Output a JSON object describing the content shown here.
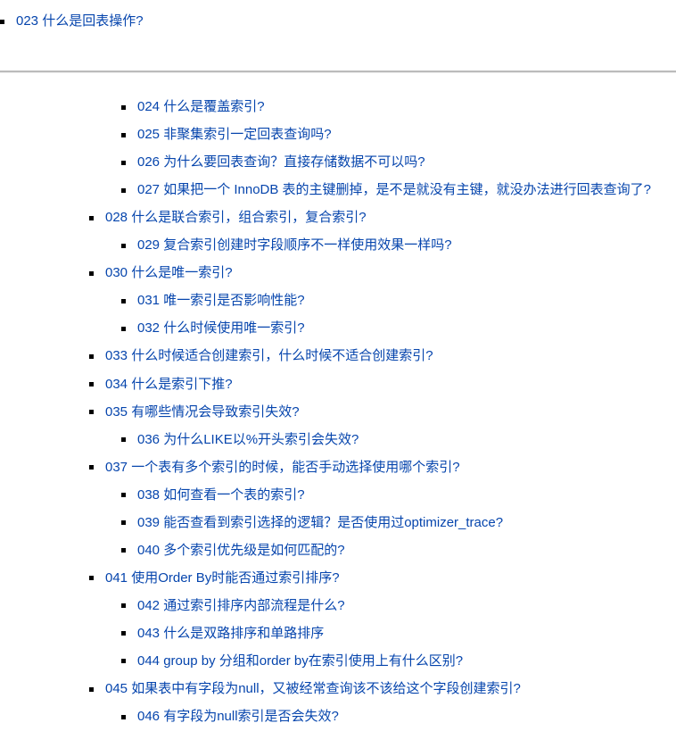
{
  "top": [
    {
      "level": 0,
      "text": "023 什么是回表操作?"
    }
  ],
  "main": [
    {
      "level": 1,
      "text": "024 什么是覆盖索引?"
    },
    {
      "level": 1,
      "text": "025 非聚集索引一定回表查询吗?"
    },
    {
      "level": 1,
      "text": "026 为什么要回表查询？直接存储数据不可以吗?"
    },
    {
      "level": 1,
      "text": "027 如果把一个 InnoDB 表的主键删掉，是不是就没有主键，就没办法进行回表查询了?"
    },
    {
      "level": 0,
      "text": "028 什么是联合索引，组合索引，复合索引?"
    },
    {
      "level": 1,
      "text": "029 复合索引创建时字段顺序不一样使用效果一样吗?"
    },
    {
      "level": 0,
      "text": "030 什么是唯一索引?"
    },
    {
      "level": 1,
      "text": "031 唯一索引是否影响性能?"
    },
    {
      "level": 1,
      "text": "032 什么时候使用唯一索引?"
    },
    {
      "level": 0,
      "text": "033 什么时候适合创建索引，什么时候不适合创建索引?"
    },
    {
      "level": 0,
      "text": "034 什么是索引下推?"
    },
    {
      "level": 0,
      "text": "035 有哪些情况会导致索引失效?"
    },
    {
      "level": 1,
      "text": "036 为什么LIKE以%开头索引会失效?"
    },
    {
      "level": 0,
      "text": "037 一个表有多个索引的时候，能否手动选择使用哪个索引?"
    },
    {
      "level": 1,
      "text": "038 如何查看一个表的索引?"
    },
    {
      "level": 1,
      "text": "039 能否查看到索引选择的逻辑？是否使用过optimizer_trace?"
    },
    {
      "level": 1,
      "text": "040 多个索引优先级是如何匹配的?"
    },
    {
      "level": 0,
      "text": "041 使用Order By时能否通过索引排序?"
    },
    {
      "level": 1,
      "text": "042 通过索引排序内部流程是什么?"
    },
    {
      "level": 1,
      "text": "043 什么是双路排序和单路排序"
    },
    {
      "level": 1,
      "text": "",
      "empty": true
    },
    {
      "level": 1,
      "text": "044 group by 分组和order by在索引使用上有什么区别?"
    },
    {
      "level": 0,
      "text": "045 如果表中有字段为null，又被经常查询该不该给这个字段创建索引?"
    },
    {
      "level": 1,
      "text": "046 有字段为null索引是否会失效?"
    }
  ]
}
